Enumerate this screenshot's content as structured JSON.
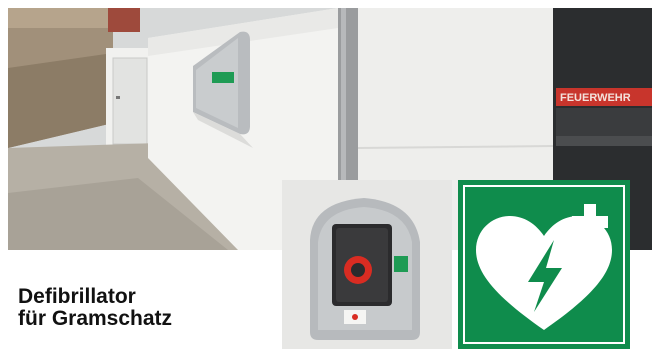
{
  "headline": {
    "line1": "Defibrillator",
    "line2": "für Gramschatz"
  },
  "scene": {
    "description_icons": [
      "building-wall",
      "aed-cabinet",
      "downpipe",
      "fire-station-door"
    ],
    "aed_cabinet_label": "AED",
    "station_sign_fragment": "FEUERWEHR"
  },
  "colors": {
    "sign_green": "#0f8c4c",
    "sign_white": "#ffffff",
    "cabinet_grey": "#b9bcbf",
    "headline_text": "#111111"
  }
}
